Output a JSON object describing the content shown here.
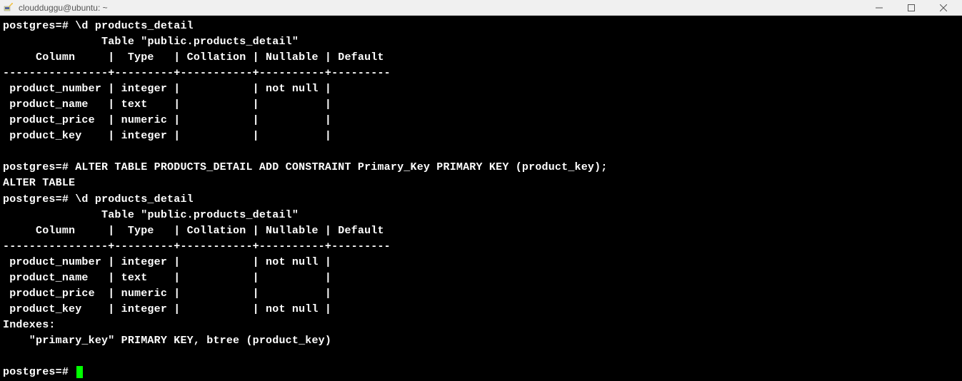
{
  "window": {
    "title": "cloudduggu@ubuntu: ~"
  },
  "terminal": {
    "prompt": "postgres=#",
    "cmd1": "\\d products_detail",
    "table1": {
      "title": "Table \"public.products_detail\"",
      "header": "     Column     |  Type   | Collation | Nullable | Default",
      "divider": "----------------+---------+-----------+----------+---------",
      "rows": [
        " product_number | integer |           | not null |",
        " product_name   | text    |           |          |",
        " product_price  | numeric |           |          |",
        " product_key    | integer |           |          |"
      ]
    },
    "cmd2": "ALTER TABLE PRODUCTS_DETAIL ADD CONSTRAINT Primary_Key PRIMARY KEY (product_key);",
    "cmd2_result": "ALTER TABLE",
    "cmd3": "\\d products_detail",
    "table2": {
      "title": "Table \"public.products_detail\"",
      "header": "     Column     |  Type   | Collation | Nullable | Default",
      "divider": "----------------+---------+-----------+----------+---------",
      "rows": [
        " product_number | integer |           | not null |",
        " product_name   | text    |           |          |",
        " product_price  | numeric |           |          |",
        " product_key    | integer |           | not null |"
      ],
      "indexes_label": "Indexes:",
      "indexes_line": "    \"primary_key\" PRIMARY KEY, btree (product_key)"
    }
  }
}
